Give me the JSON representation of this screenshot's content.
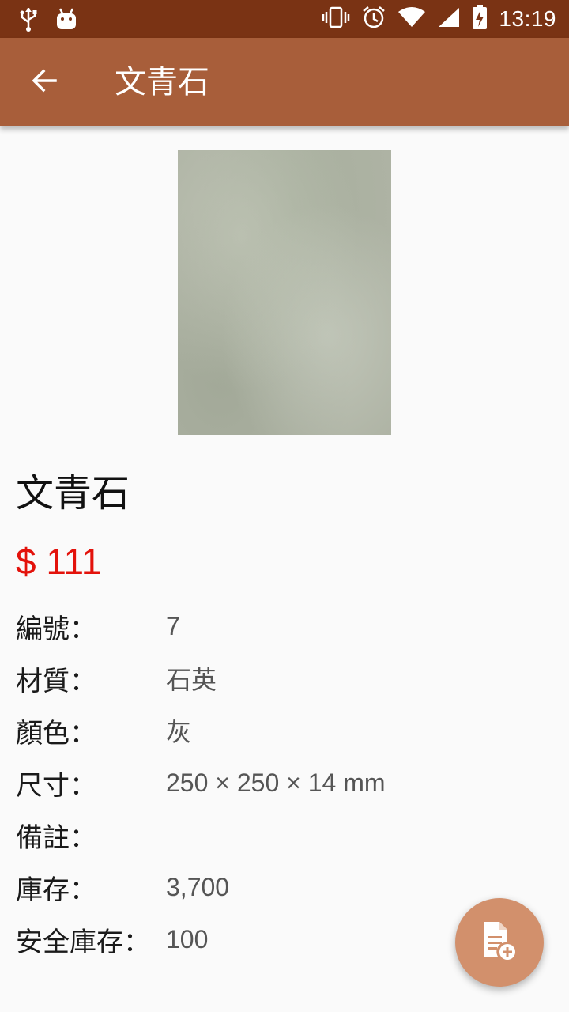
{
  "status_bar": {
    "time": "13:19",
    "left_icons": [
      "usb-icon",
      "android-debug-icon"
    ],
    "right_icons": [
      "vibrate-icon",
      "alarm-icon",
      "wifi-icon",
      "cellular-signal-icon",
      "battery-charging-icon"
    ],
    "background_color": "#7a3314"
  },
  "app_bar": {
    "title": "文青石",
    "back_icon": "arrow-back-icon",
    "background_color": "#a85e3a"
  },
  "product": {
    "image_description_color": "#aeb3a4",
    "name": "文青石",
    "price": "$ 111",
    "price_color": "#e3120b",
    "details": [
      {
        "label": "編號：",
        "value": "7"
      },
      {
        "label": "材質：",
        "value": "石英"
      },
      {
        "label": "顏色：",
        "value": "灰"
      },
      {
        "label": "尺寸：",
        "value": "250 × 250 ×  14 mm"
      },
      {
        "label": "備註：",
        "value": ""
      },
      {
        "label": "庫存：",
        "value": "3,700"
      },
      {
        "label": "安全庫存：",
        "value": "100"
      }
    ]
  },
  "fab": {
    "icon": "note-add-icon",
    "background_color": "#d2906c"
  }
}
